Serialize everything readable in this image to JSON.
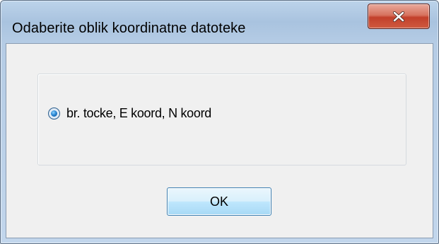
{
  "dialog": {
    "title": "Odaberite oblik koordinatne datoteke",
    "close_icon": "close-icon"
  },
  "options": {
    "radio_label": "br. tocke, E koord, N koord",
    "selected": true
  },
  "buttons": {
    "ok_label": "OK"
  },
  "colors": {
    "title_bar": "#a9c3df",
    "close_button": "#c2402b",
    "client_area": "#f0f0f0",
    "ok_button_border": "#3c7fb1",
    "radio_selected": "#2b87d3"
  }
}
